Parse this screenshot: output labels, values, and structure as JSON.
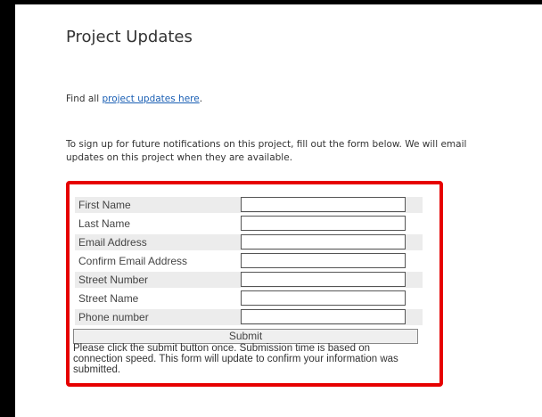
{
  "page": {
    "title": "Project Updates",
    "find_prefix": "Find all ",
    "find_link": "project updates here",
    "find_suffix": ".",
    "signup_text": "To sign up for future notifications on this project, fill out the form below. We will email updates on this project when they are available."
  },
  "form": {
    "fields": [
      {
        "label": "First Name",
        "value": ""
      },
      {
        "label": "Last Name",
        "value": ""
      },
      {
        "label": "Email Address",
        "value": ""
      },
      {
        "label": "Confirm Email Address",
        "value": ""
      },
      {
        "label": "Street Number",
        "value": ""
      },
      {
        "label": "Street Name",
        "value": ""
      },
      {
        "label": "Phone number",
        "value": ""
      }
    ],
    "submit_label": "Submit",
    "note": "Please click the submit button once.  Submission time is based on connection speed. This form will update to confirm your information was submitted."
  },
  "colors": {
    "highlight_border": "#e60000",
    "link": "#1a5fb4",
    "row_shade": "#ececec"
  }
}
